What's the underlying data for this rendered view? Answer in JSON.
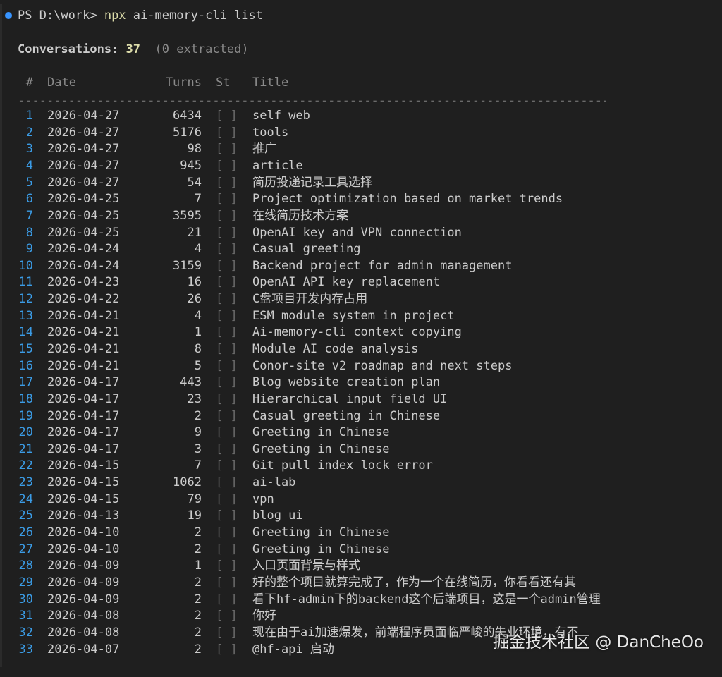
{
  "prompt": {
    "path": "PS D:\\work> ",
    "command_bin": "npx",
    "command_args": " ai-memory-cli list"
  },
  "summary": {
    "label": "Conversations: ",
    "count": "37",
    "extra": "(0 extracted)"
  },
  "columns": {
    "num": "#",
    "date": "Date",
    "turns": "Turns",
    "status": "St",
    "title": "Title"
  },
  "separator": "-------------------------------------------------------------------------------------------------------------------",
  "rows": [
    {
      "num": "1",
      "date": "2026-04-27",
      "turns": "6434",
      "status": "[ ]",
      "title": "self web"
    },
    {
      "num": "2",
      "date": "2026-04-27",
      "turns": "5176",
      "status": "[ ]",
      "title": "tools"
    },
    {
      "num": "3",
      "date": "2026-04-27",
      "turns": "98",
      "status": "[ ]",
      "title": "推广"
    },
    {
      "num": "4",
      "date": "2026-04-27",
      "turns": "945",
      "status": "[ ]",
      "title": "article"
    },
    {
      "num": "5",
      "date": "2026-04-27",
      "turns": "54",
      "status": "[ ]",
      "title": "简历投递记录工具选择"
    },
    {
      "num": "6",
      "date": "2026-04-25",
      "turns": "7",
      "status": "[ ]",
      "title_underlined": "Project",
      "title": " optimization based on market trends"
    },
    {
      "num": "7",
      "date": "2026-04-25",
      "turns": "3595",
      "status": "[ ]",
      "title": "在线简历技术方案"
    },
    {
      "num": "8",
      "date": "2026-04-25",
      "turns": "21",
      "status": "[ ]",
      "title": "OpenAI key and VPN connection"
    },
    {
      "num": "9",
      "date": "2026-04-24",
      "turns": "4",
      "status": "[ ]",
      "title": "Casual greeting"
    },
    {
      "num": "10",
      "date": "2026-04-24",
      "turns": "3159",
      "status": "[ ]",
      "title": "Backend project for admin management"
    },
    {
      "num": "11",
      "date": "2026-04-23",
      "turns": "16",
      "status": "[ ]",
      "title": "OpenAI API key replacement"
    },
    {
      "num": "12",
      "date": "2026-04-22",
      "turns": "26",
      "status": "[ ]",
      "title": "C盘项目开发内存占用"
    },
    {
      "num": "13",
      "date": "2026-04-21",
      "turns": "4",
      "status": "[ ]",
      "title": "ESM module system in project"
    },
    {
      "num": "14",
      "date": "2026-04-21",
      "turns": "1",
      "status": "[ ]",
      "title": "Ai-memory-cli context copying"
    },
    {
      "num": "15",
      "date": "2026-04-21",
      "turns": "8",
      "status": "[ ]",
      "title": "Module AI code analysis"
    },
    {
      "num": "16",
      "date": "2026-04-21",
      "turns": "5",
      "status": "[ ]",
      "title": "Conor-site v2 roadmap and next steps"
    },
    {
      "num": "17",
      "date": "2026-04-17",
      "turns": "443",
      "status": "[ ]",
      "title": "Blog website creation plan"
    },
    {
      "num": "18",
      "date": "2026-04-17",
      "turns": "23",
      "status": "[ ]",
      "title": "Hierarchical input field UI"
    },
    {
      "num": "19",
      "date": "2026-04-17",
      "turns": "2",
      "status": "[ ]",
      "title": "Casual greeting in Chinese"
    },
    {
      "num": "20",
      "date": "2026-04-17",
      "turns": "9",
      "status": "[ ]",
      "title": "Greeting in Chinese"
    },
    {
      "num": "21",
      "date": "2026-04-17",
      "turns": "3",
      "status": "[ ]",
      "title": "Greeting in Chinese"
    },
    {
      "num": "22",
      "date": "2026-04-15",
      "turns": "7",
      "status": "[ ]",
      "title": "Git pull index lock error"
    },
    {
      "num": "23",
      "date": "2026-04-15",
      "turns": "1062",
      "status": "[ ]",
      "title": "ai-lab"
    },
    {
      "num": "24",
      "date": "2026-04-15",
      "turns": "79",
      "status": "[ ]",
      "title": "vpn"
    },
    {
      "num": "25",
      "date": "2026-04-13",
      "turns": "19",
      "status": "[ ]",
      "title": "blog ui"
    },
    {
      "num": "26",
      "date": "2026-04-10",
      "turns": "2",
      "status": "[ ]",
      "title": "Greeting in Chinese"
    },
    {
      "num": "27",
      "date": "2026-04-10",
      "turns": "2",
      "status": "[ ]",
      "title": "Greeting in Chinese"
    },
    {
      "num": "28",
      "date": "2026-04-09",
      "turns": "1",
      "status": "[ ]",
      "title": "入口页面背景与样式"
    },
    {
      "num": "29",
      "date": "2026-04-09",
      "turns": "2",
      "status": "[ ]",
      "title": "好的整个项目就算完成了，作为一个在线简历，你看看还有其"
    },
    {
      "num": "30",
      "date": "2026-04-09",
      "turns": "2",
      "status": "[ ]",
      "title": "看下hf-admin下的backend这个后端项目，这是一个admin管理"
    },
    {
      "num": "31",
      "date": "2026-04-08",
      "turns": "2",
      "status": "[ ]",
      "title": "你好"
    },
    {
      "num": "32",
      "date": "2026-04-08",
      "turns": "2",
      "status": "[ ]",
      "title": "现在由于ai加速爆发，前端程序员面临严峻的失业环境，有不"
    },
    {
      "num": "33",
      "date": "2026-04-07",
      "turns": "2",
      "status": "[ ]",
      "title": "@hf-api 启动"
    }
  ],
  "watermark": "掘金技术社区 @ DanCheOo",
  "colors": {
    "background": "#1f1f1f",
    "row_number": "#3b9ce6",
    "command": "#dcdcaa",
    "prompt_dot": "#3794ff"
  }
}
